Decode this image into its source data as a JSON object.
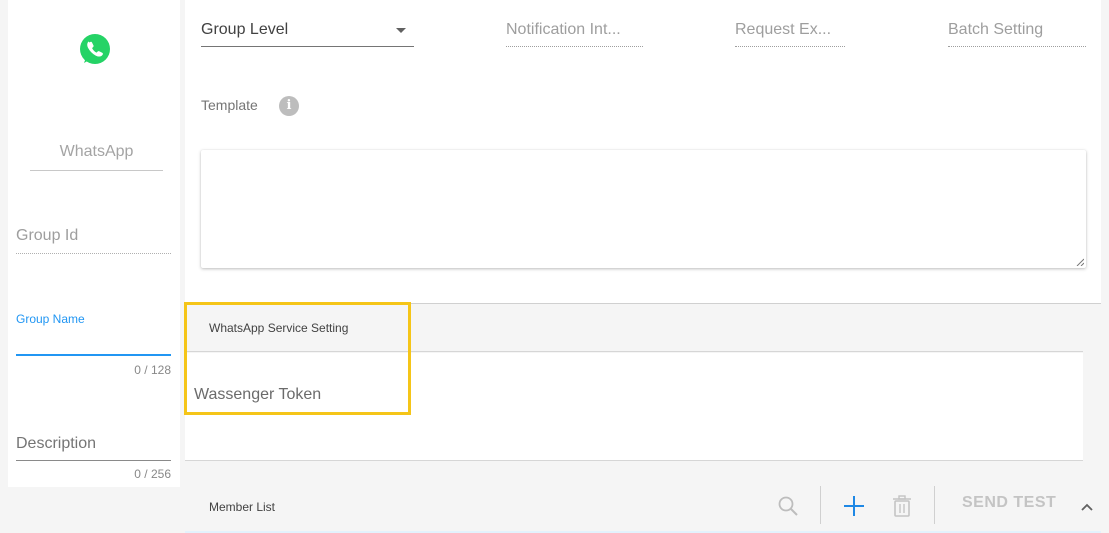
{
  "left": {
    "channel_name": "WhatsApp",
    "group_id_placeholder": "Group Id",
    "group_name_label": "Group Name",
    "group_name_counter": "0 / 128",
    "description_placeholder": "Description",
    "description_counter": "0 / 256",
    "logo_icon": "whatsapp-logo-icon"
  },
  "top_fields": {
    "group_level": "Group Level",
    "notification_interval": "Notification Int...",
    "request_expiry": "Request Ex...",
    "batch_setting": "Batch Setting"
  },
  "template": {
    "label": "Template",
    "info_icon": "info-icon",
    "value": ""
  },
  "service": {
    "title": "WhatsApp Service Setting",
    "token_label": "Wassenger Token"
  },
  "member_list": {
    "title": "Member List",
    "send_test_label": "SEND TEST",
    "icons": [
      "search-icon",
      "add-icon",
      "trash-icon",
      "chevron-up-icon"
    ]
  },
  "colors": {
    "accent_blue": "#2196f3",
    "highlight_yellow": "#f5c518",
    "whatsapp_green": "#25d366"
  }
}
